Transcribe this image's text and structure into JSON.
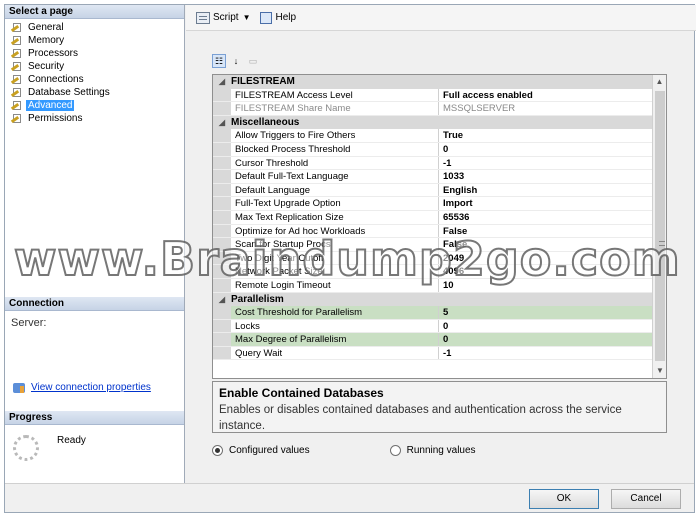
{
  "left": {
    "select_page_header": "Select a page",
    "pages": [
      {
        "label": "General",
        "selected": false
      },
      {
        "label": "Memory",
        "selected": false
      },
      {
        "label": "Processors",
        "selected": false
      },
      {
        "label": "Security",
        "selected": false
      },
      {
        "label": "Connections",
        "selected": false
      },
      {
        "label": "Database Settings",
        "selected": false
      },
      {
        "label": "Advanced",
        "selected": true
      },
      {
        "label": "Permissions",
        "selected": false
      }
    ],
    "connection_header": "Connection",
    "server_label": "Server:",
    "view_connection_link": "View connection properties",
    "progress_header": "Progress",
    "progress_status": "Ready"
  },
  "toolbar": {
    "script_label": "Script",
    "help_label": "Help"
  },
  "grid": {
    "categories": [
      {
        "name": "FILESTREAM",
        "rows": [
          {
            "name": "FILESTREAM Access Level",
            "value": "Full access enabled",
            "readonly": false,
            "highlight": false
          },
          {
            "name": "FILESTREAM Share Name",
            "value": "MSSQLSERVER",
            "readonly": true,
            "highlight": false
          }
        ]
      },
      {
        "name": "Miscellaneous",
        "rows": [
          {
            "name": "Allow Triggers to Fire Others",
            "value": "True",
            "readonly": false,
            "highlight": false
          },
          {
            "name": "Blocked Process Threshold",
            "value": "0",
            "readonly": false,
            "highlight": false
          },
          {
            "name": "Cursor Threshold",
            "value": "-1",
            "readonly": false,
            "highlight": false
          },
          {
            "name": "Default Full-Text Language",
            "value": "1033",
            "readonly": false,
            "highlight": false
          },
          {
            "name": "Default Language",
            "value": "English",
            "readonly": false,
            "highlight": false
          },
          {
            "name": "Full-Text Upgrade Option",
            "value": "Import",
            "readonly": false,
            "highlight": false
          },
          {
            "name": "Max Text Replication Size",
            "value": "65536",
            "readonly": false,
            "highlight": false
          },
          {
            "name": "Optimize for Ad hoc Workloads",
            "value": "False",
            "readonly": false,
            "highlight": false
          },
          {
            "name": "Scan for Startup Procs",
            "value": "False",
            "readonly": false,
            "highlight": false
          },
          {
            "name": "Two Digit Year Cutoff",
            "value": "2049",
            "readonly": false,
            "highlight": false
          },
          {
            "name": "Network Packet Size",
            "value": "4096",
            "readonly": false,
            "highlight": false
          },
          {
            "name": "Remote Login Timeout",
            "value": "10",
            "readonly": false,
            "highlight": false
          }
        ]
      },
      {
        "name": "Parallelism",
        "rows": [
          {
            "name": "Cost Threshold for Parallelism",
            "value": "5",
            "readonly": false,
            "highlight": true
          },
          {
            "name": "Locks",
            "value": "0",
            "readonly": false,
            "highlight": false
          },
          {
            "name": "Max Degree of Parallelism",
            "value": "0",
            "readonly": false,
            "highlight": true
          },
          {
            "name": "Query Wait",
            "value": "-1",
            "readonly": false,
            "highlight": false
          }
        ]
      }
    ]
  },
  "description": {
    "title": "Enable Contained Databases",
    "text": "Enables or disables contained databases and authentication across the service instance."
  },
  "options": {
    "configured_label": "Configured values",
    "running_label": "Running values",
    "selected": "configured"
  },
  "buttons": {
    "ok": "OK",
    "cancel": "Cancel"
  },
  "watermark": "www.Braindump2go.com"
}
